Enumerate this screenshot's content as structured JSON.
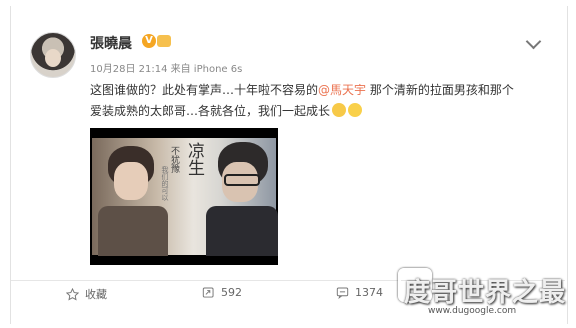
{
  "post": {
    "username": "張曉晨",
    "verified_badge": "V",
    "meta": "10月28日 21:14 来自 iPhone 6s",
    "text_1": "这图谁做的？此处有掌声…十年啦不容易的",
    "mention": "@馬天宇",
    "text_2": " 那个清新的拉面男孩和那个",
    "text_3": "爱装成熟的太郎哥…各就各位，我们一起成长",
    "image_title": "凉生",
    "image_subtitle": "不犹豫",
    "image_caption": "我们的可以"
  },
  "actions": {
    "favorite": "收藏",
    "repost": "592",
    "comment": "1374"
  },
  "watermark": {
    "brand": "度哥世界之最",
    "url": "www.dugoogle.com"
  },
  "icons": {
    "options": "chevron-down-icon",
    "favorite": "star-icon",
    "repost": "repost-icon",
    "comment": "comment-icon"
  }
}
